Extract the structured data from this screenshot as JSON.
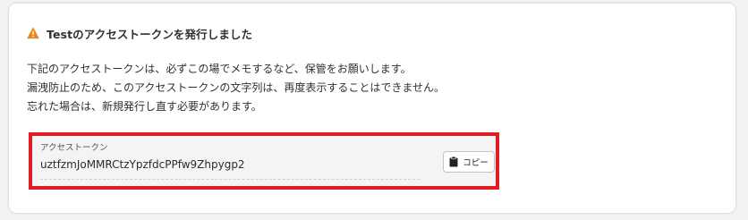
{
  "notice": {
    "icon": "warning-icon",
    "icon_color": "#e8891a",
    "title": "Testのアクセストークンを発行しました"
  },
  "description": {
    "lines": [
      "下記のアクセストークンは、必ずこの場でメモするなど、保管をお願いします。",
      "漏洩防止のため、このアクセストークンの文字列は、再度表示することはできません。",
      "忘れた場合は、新規発行し直す必要があります。"
    ]
  },
  "token": {
    "label": "アクセストークン",
    "value": "uztfzmJoMMRCtzYpzfdcPPfw9Zhpygp2",
    "highlight_color": "#e31b23"
  },
  "copy_button": {
    "icon": "clipboard-icon",
    "label": "コピー"
  }
}
